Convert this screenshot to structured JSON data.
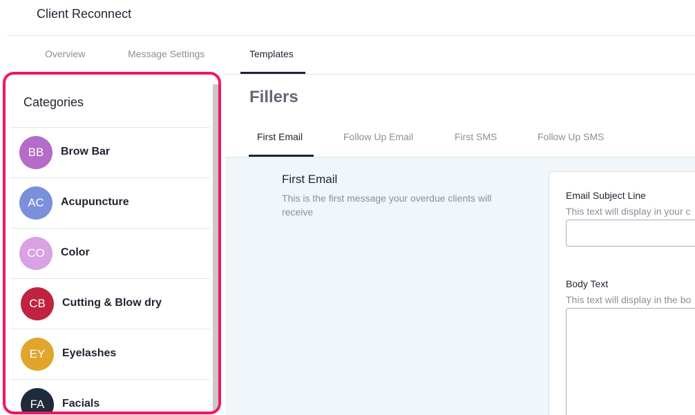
{
  "app": {
    "title": "Client Reconnect"
  },
  "top_tabs": [
    {
      "label": "Overview"
    },
    {
      "label": "Message Settings"
    },
    {
      "label": "Templates"
    }
  ],
  "sidebar": {
    "title": "Categories",
    "items": [
      {
        "initials": "BB",
        "label": "Brow Bar",
        "color": "#b56bc8"
      },
      {
        "initials": "AC",
        "label": "Acupuncture",
        "color": "#7b8fdb"
      },
      {
        "initials": "CO",
        "label": "Color",
        "color": "#d9a2e2"
      },
      {
        "initials": "CB",
        "label": "Cutting & Blow dry",
        "color": "#c0223f"
      },
      {
        "initials": "EY",
        "label": "Eyelashes",
        "color": "#e0a52a"
      },
      {
        "initials": "FA",
        "label": "Facials",
        "color": "#1f2a3a"
      }
    ]
  },
  "main": {
    "title": "Fillers",
    "sub_tabs": [
      {
        "label": "First Email"
      },
      {
        "label": "Follow Up Email"
      },
      {
        "label": "First SMS"
      },
      {
        "label": "Follow Up SMS"
      }
    ],
    "section": {
      "title": "First Email",
      "description": "This is the first message your overdue clients will receive"
    },
    "form": {
      "subject_label": "Email Subject Line",
      "subject_hint": "This text will display in your c",
      "subject_value": "",
      "body_label": "Body Text",
      "body_hint": "This text will display in the bo",
      "body_value": ""
    }
  }
}
